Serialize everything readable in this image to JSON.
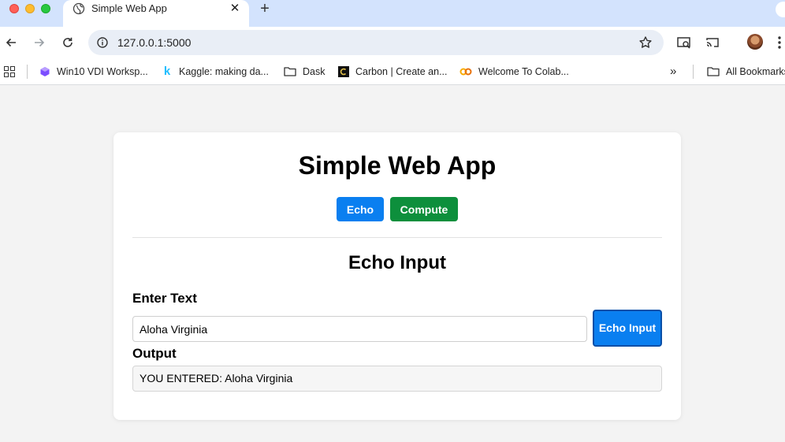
{
  "browser": {
    "tab": {
      "title": "Simple Web App",
      "favicon": "globe-icon"
    },
    "url": "127.0.0.1:5000",
    "bookmarks": [
      {
        "label": "Win10 VDI Worksp...",
        "icon": "vdi-icon"
      },
      {
        "label": "Kaggle: making da...",
        "icon": "kaggle-icon"
      },
      {
        "label": "Dask",
        "icon": "folder-icon"
      },
      {
        "label": "Carbon | Create an...",
        "icon": "carbon-icon"
      },
      {
        "label": "Welcome To Colab...",
        "icon": "colab-icon"
      }
    ],
    "all_bookmarks_label": "All Bookmarks",
    "colors": {
      "tabstrip": "#d3e3fd",
      "omnibox": "#e9eef6"
    }
  },
  "app": {
    "title": "Simple Web App",
    "nav": {
      "echo_label": "Echo",
      "compute_label": "Compute"
    },
    "section_title": "Echo Input",
    "input_label": "Enter Text",
    "input_value": "Aloha Virginia",
    "echo_button_label": "Echo Input",
    "output_label": "Output",
    "output_text": "YOU ENTERED: Aloha Virginia",
    "colors": {
      "echo": "#0a7ff0",
      "compute": "#0d8f3c"
    }
  }
}
